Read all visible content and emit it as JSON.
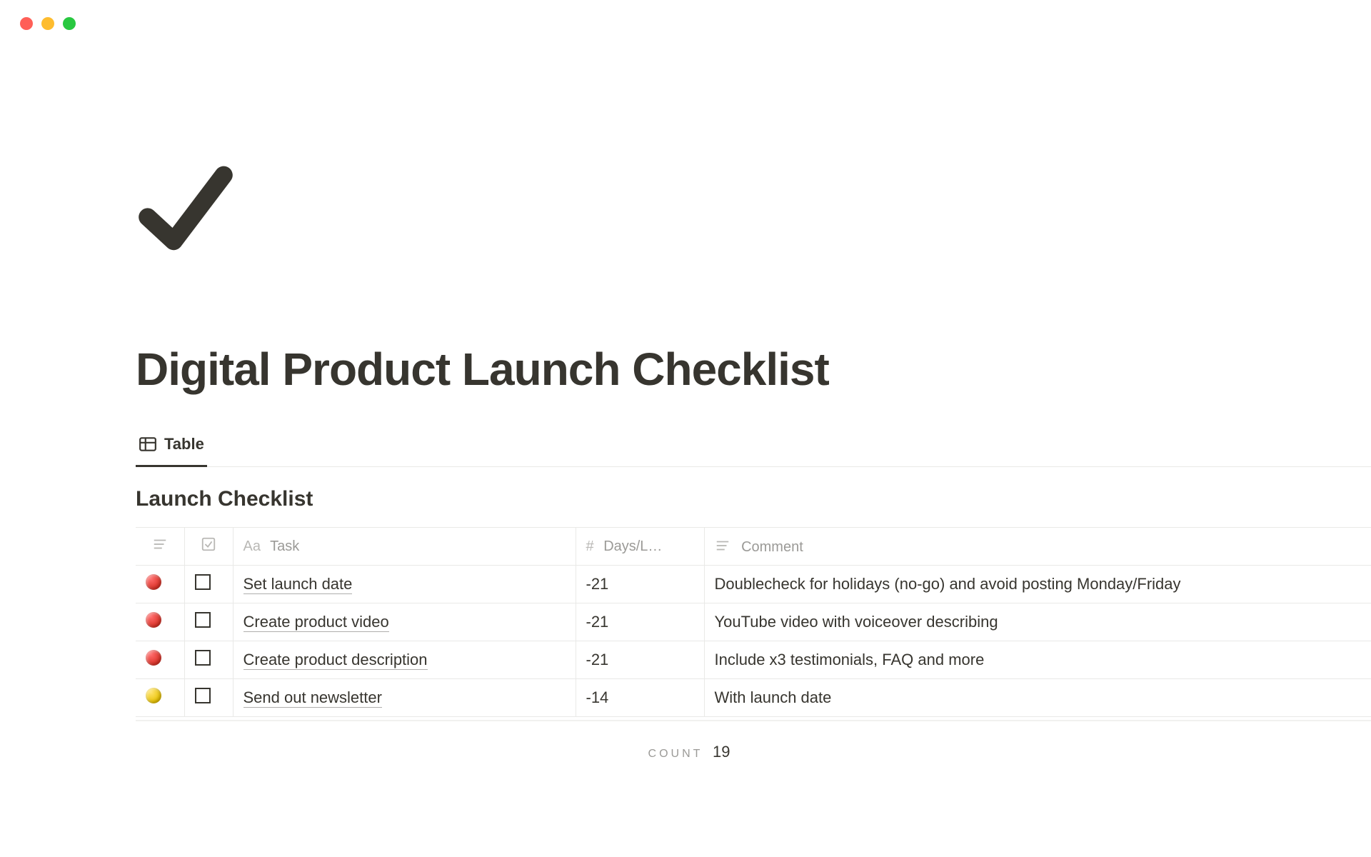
{
  "page": {
    "title": "Digital Product Launch Checklist"
  },
  "view": {
    "tab_label": "Table"
  },
  "db": {
    "title": "Launch Checklist",
    "headers": {
      "task": "Task",
      "days": "Days/L…",
      "comment": "Comment"
    },
    "rows": [
      {
        "status": "red",
        "checked": false,
        "task": "Set launch date",
        "days": "-21",
        "comment": "Doublecheck for holidays (no-go) and avoid posting Monday/Friday"
      },
      {
        "status": "red",
        "checked": false,
        "task": "Create product video",
        "days": "-21",
        "comment": "YouTube video with voiceover describing"
      },
      {
        "status": "red",
        "checked": false,
        "task": "Create product description",
        "days": "-21",
        "comment": "Include x3 testimonials, FAQ and more"
      },
      {
        "status": "yellow",
        "checked": false,
        "task": "Send out newsletter",
        "days": "-14",
        "comment": "With launch date"
      }
    ],
    "count": {
      "label": "COUNT",
      "value": "19"
    }
  }
}
